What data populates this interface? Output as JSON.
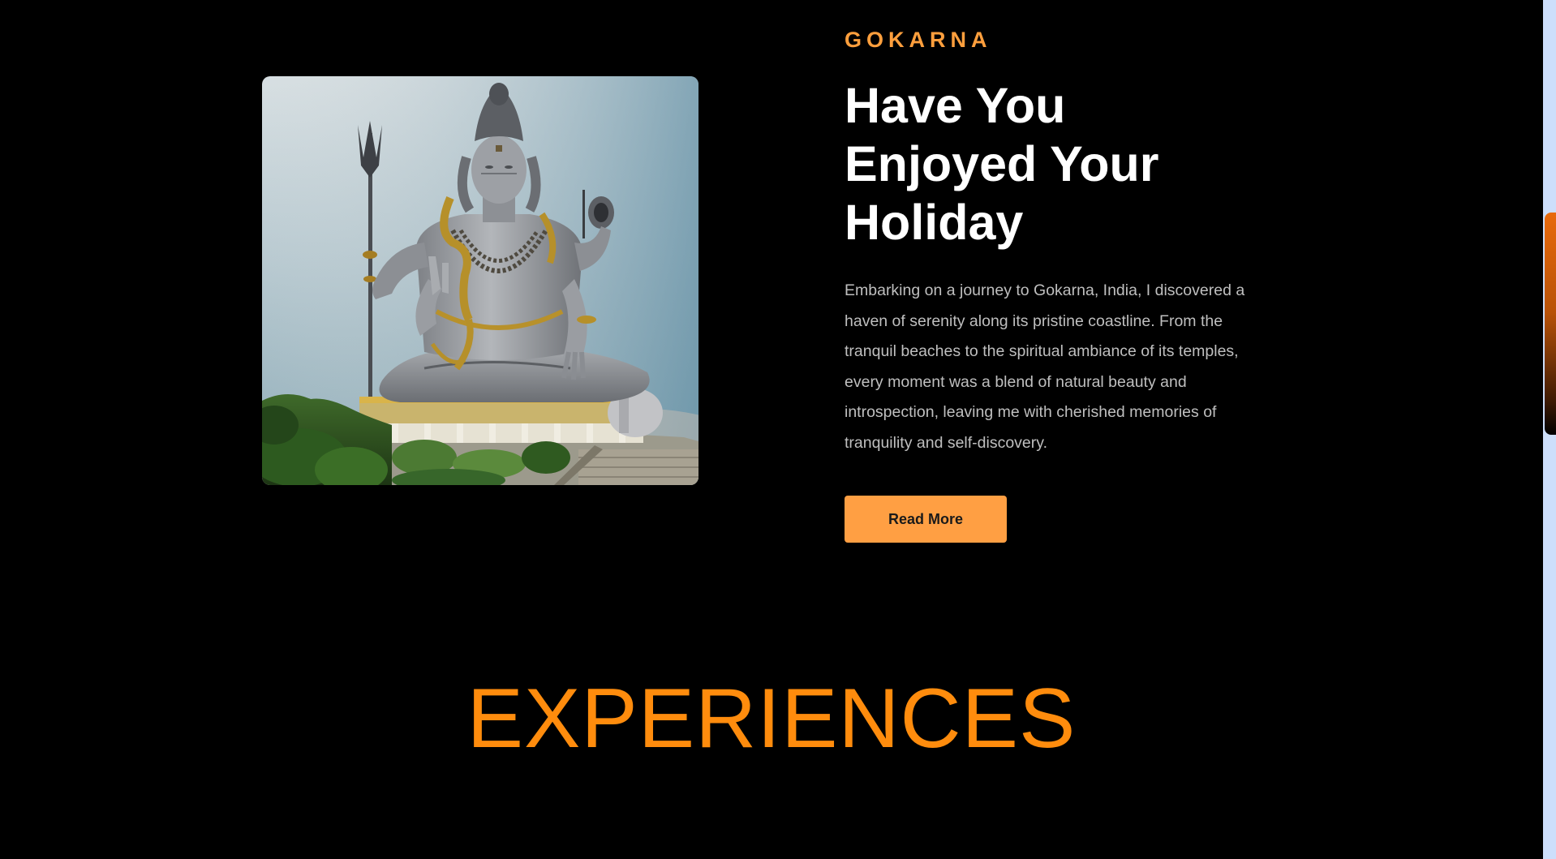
{
  "destination": {
    "eyebrow": "GOKARNA",
    "headline": "Have You Enjoyed Your Holiday",
    "description": "Embarking on a journey to Gokarna, India, I discovered a haven of serenity along its pristine coastline. From the tranquil beaches to the spiritual ambiance of its temples, every moment was a blend of natural beauty and introspection, leaving me with cherished memories of tranquility and self-discovery.",
    "cta_label": "Read More"
  },
  "experiences": {
    "title": "EXPERIENCES"
  },
  "colors": {
    "accent": "#ff9f43",
    "section_title": "#ff8c0d",
    "background": "#000000"
  }
}
